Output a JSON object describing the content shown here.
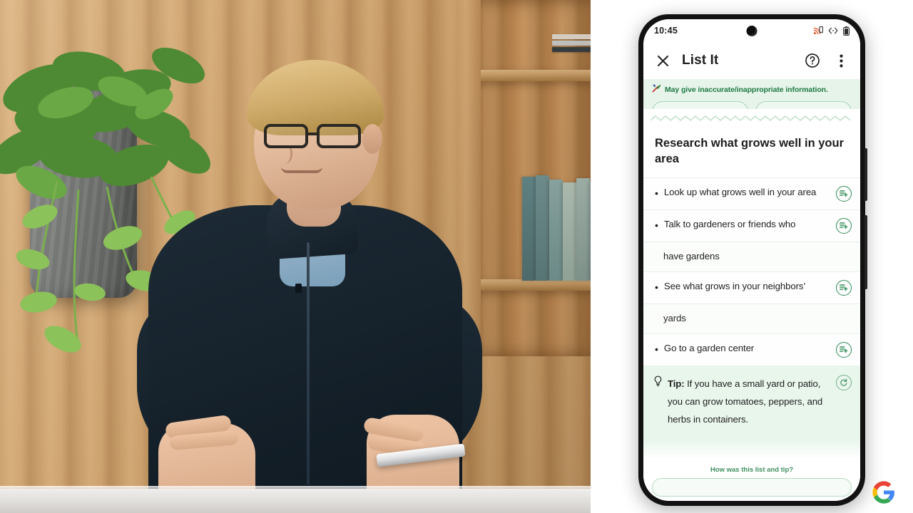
{
  "scene": {
    "description": "Person in dark zip jacket holding a phone at a counter, wood slat wall, plant and bookshelf behind"
  },
  "brand": {
    "logo": "google-logo"
  },
  "phone": {
    "status_bar": {
      "clock": "10:45",
      "icons": [
        "cast-signal-icon",
        "code-brackets-icon",
        "battery-icon"
      ]
    },
    "app_bar": {
      "close_icon": "close-icon",
      "title": "List It",
      "help_icon": "help-circle-icon",
      "overflow_icon": "more-vertical-icon"
    },
    "banner": {
      "icon": "tools-icon",
      "text": "May give inaccurate/inappropriate information."
    },
    "headline": "Research what grows well in your area",
    "list_items": [
      {
        "bullet": "•",
        "text": "Look up what grows well in your area",
        "action": "add-to-list-icon",
        "continuation": false
      },
      {
        "bullet": "•",
        "text": "Talk to gardeners or friends who",
        "action": "add-to-list-icon",
        "continuation": false
      },
      {
        "bullet": "",
        "text": "have gardens",
        "action": "",
        "continuation": true
      },
      {
        "bullet": "•",
        "text": "See what grows in your neighbors’",
        "action": "add-to-list-icon",
        "continuation": false
      },
      {
        "bullet": "",
        "text": "yards",
        "action": "",
        "continuation": true
      },
      {
        "bullet": "•",
        "text": "Go to a garden center",
        "action": "add-to-list-icon",
        "continuation": false
      }
    ],
    "tip": {
      "icon": "lightbulb-icon",
      "label": "Tip:",
      "text": "If you have a small yard or patio, you can grow tomatoes, peppers, and herbs in containers.",
      "refresh_icon": "refresh-icon"
    },
    "feedback": "How was this list and tip?"
  },
  "colors": {
    "accent_green": "#1e7a43",
    "banner_bg": "#e7f4ea",
    "tip_bg": "#e9f6ec",
    "circle_stroke": "#2e8b57",
    "text": "#1f1f1f",
    "frame": "#121212"
  }
}
